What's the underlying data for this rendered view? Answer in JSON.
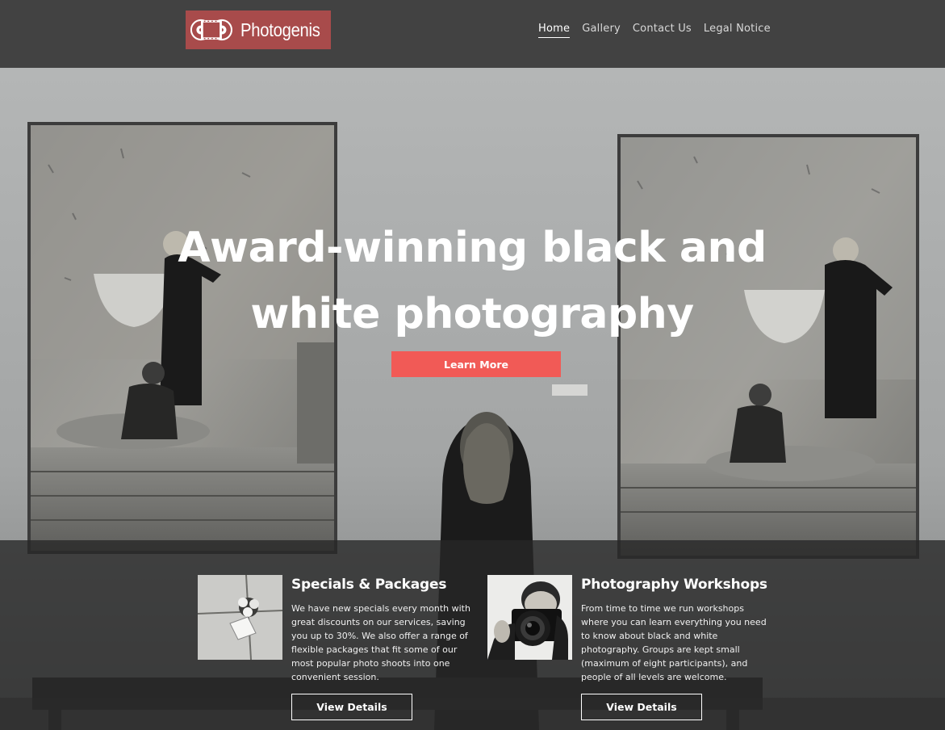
{
  "brand": {
    "name": "Photogenis",
    "logo_color": "#a84b4b"
  },
  "nav": {
    "items": [
      {
        "label": "Home",
        "active": true
      },
      {
        "label": "Gallery",
        "active": false
      },
      {
        "label": "Contact Us",
        "active": false
      },
      {
        "label": "Legal Notice",
        "active": false
      }
    ]
  },
  "hero": {
    "title": "Award-winning black and white photography",
    "cta_label": "Learn More",
    "cta_color": "#f15a56"
  },
  "features": [
    {
      "title": "Specials & Packages",
      "text": "We have new specials every month with great discounts on our services, saving you up to 30%. We also offer a range of flexible packages that fit some of our most popular photo shoots into one convenient session.",
      "button_label": "View Details",
      "thumb_icon": "gift-photo"
    },
    {
      "title": "Photography Workshops",
      "text": "From time to time we run workshops where you can learn everything you need to know about black and white photography. Groups are kept small (maximum of eight participants), and people of all levels are welcome.",
      "button_label": "View Details",
      "thumb_icon": "photographer-camera-photo"
    }
  ]
}
